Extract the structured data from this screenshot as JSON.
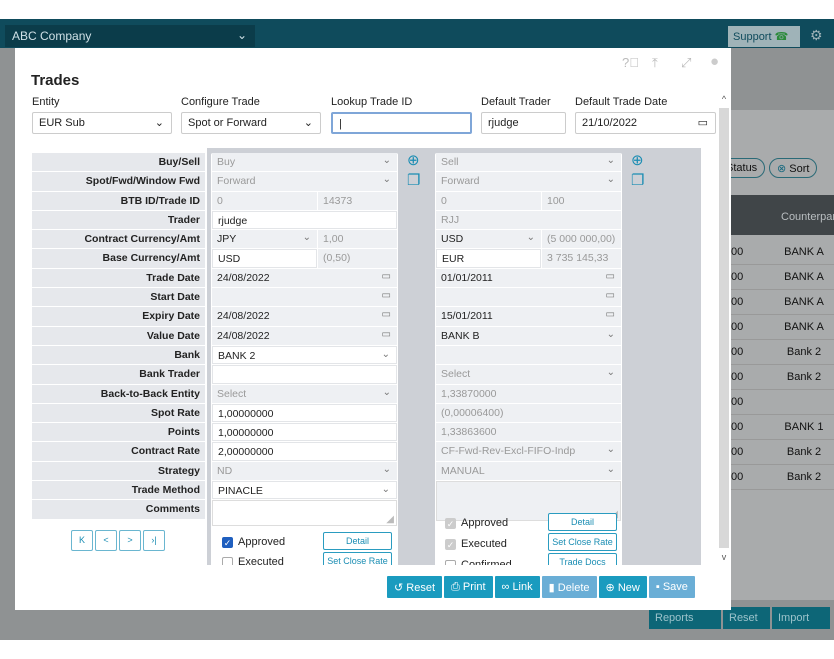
{
  "app": {
    "company": "ABC Company",
    "support": "Support"
  },
  "background": {
    "status_pill": "Status",
    "sort_pill": "Sort",
    "column_header": "Counterparty",
    "rows": [
      {
        "n": "00",
        "c": "BANK A"
      },
      {
        "n": "00",
        "c": "BANK A"
      },
      {
        "n": "00",
        "c": "BANK A"
      },
      {
        "n": "00",
        "c": "BANK A"
      },
      {
        "n": "00",
        "c": "Bank 2"
      },
      {
        "n": "00",
        "c": "Bank 2"
      },
      {
        "n": "00",
        "c": ""
      },
      {
        "n": "00",
        "c": "BANK 1"
      },
      {
        "n": "00",
        "c": "Bank 2"
      },
      {
        "n": "00",
        "c": "Bank 2"
      }
    ],
    "buttons": [
      "Reports",
      "Reset",
      "Import"
    ]
  },
  "modal": {
    "title": "Trades",
    "header": {
      "entity_label": "Entity",
      "entity_value": "EUR Sub",
      "configure_label": "Configure Trade",
      "configure_value": "Spot or Forward",
      "lookup_label": "Lookup Trade ID",
      "lookup_value": "",
      "trader_label": "Default Trader",
      "trader_value": "rjudge",
      "date_label": "Default Trade Date",
      "date_value": "21/10/2022"
    },
    "labels": [
      "Buy/Sell",
      "Spot/Fwd/Window Fwd",
      "BTB ID/Trade ID",
      "Trader",
      "Contract Currency/Amt",
      "Base Currency/Amt",
      "Trade Date",
      "Start Date",
      "Expiry Date",
      "Value Date",
      "Bank",
      "Bank Trader",
      "Back-to-Back Entity",
      "Spot Rate",
      "Points",
      "Contract Rate",
      "Strategy",
      "Trade Method",
      "Comments"
    ],
    "left": [
      [
        {
          "t": "Buy",
          "i": "dd",
          "s": "m"
        }
      ],
      [
        {
          "t": "Forward",
          "i": "dd",
          "s": "m"
        }
      ],
      [
        {
          "t": "0",
          "s": "m"
        },
        {
          "t": "14373",
          "s": "m"
        }
      ],
      [
        {
          "t": "rjudge",
          "s": "w"
        }
      ],
      [
        {
          "t": "JPY",
          "i": "dd"
        },
        {
          "t": "1,00",
          "s": "m"
        }
      ],
      [
        {
          "t": "USD",
          "s": "w"
        },
        {
          "t": "(0,50)",
          "s": "m"
        }
      ],
      [
        {
          "t": "24/08/2022",
          "i": "cal"
        }
      ],
      [
        {
          "t": "",
          "i": "cal"
        }
      ],
      [
        {
          "t": "24/08/2022",
          "i": "cal"
        }
      ],
      [
        {
          "t": "24/08/2022",
          "i": "cal"
        }
      ],
      [
        {
          "t": "BANK 2",
          "i": "dd",
          "s": "w"
        }
      ],
      [
        {
          "t": "",
          "s": "w"
        }
      ],
      [
        {
          "t": "Select",
          "i": "dd",
          "s": "m"
        }
      ],
      [
        {
          "t": "1,00000000",
          "s": "w"
        }
      ],
      [
        {
          "t": "1,00000000",
          "s": "w"
        }
      ],
      [
        {
          "t": "2,00000000",
          "s": "w"
        }
      ],
      [
        {
          "t": "ND",
          "i": "dd",
          "s": "m"
        }
      ],
      [
        {
          "t": "PINACLE",
          "i": "dd",
          "s": "w"
        }
      ],
      [
        {
          "t": "",
          "ta": true
        }
      ]
    ],
    "right": [
      [
        {
          "t": "Sell",
          "i": "dd",
          "s": "m"
        }
      ],
      [
        {
          "t": "Forward",
          "i": "dd",
          "s": "m"
        }
      ],
      [
        {
          "t": "0",
          "s": "m"
        },
        {
          "t": "100",
          "s": "m"
        }
      ],
      [
        {
          "t": "RJJ",
          "s": "m"
        }
      ],
      [
        {
          "t": "USD",
          "i": "dd"
        },
        {
          "t": "(5 000 000,00)",
          "s": "m"
        }
      ],
      [
        {
          "t": "EUR",
          "s": "w"
        },
        {
          "t": "3 735 145,33",
          "s": "m"
        }
      ],
      [
        {
          "t": "01/01/2011",
          "i": "cal"
        }
      ],
      [
        {
          "t": "",
          "i": "cal"
        }
      ],
      [
        {
          "t": "15/01/2011",
          "i": "cal"
        }
      ],
      [
        {
          "t": "BANK B",
          "i": "dd"
        }
      ],
      [
        {
          "t": ""
        }
      ],
      [
        {
          "t": "Select",
          "i": "dd",
          "s": "m"
        }
      ],
      [
        {
          "t": "1,33870000",
          "s": "m"
        }
      ],
      [
        {
          "t": "(0,00006400)",
          "s": "m"
        }
      ],
      [
        {
          "t": "1,33863600",
          "s": "m"
        }
      ],
      [
        {
          "t": "CF-Fwd-Rev-Excl-FIFO-Indp",
          "i": "dd",
          "s": "m"
        }
      ],
      [
        {
          "t": "MANUAL",
          "i": "dd",
          "s": "m"
        }
      ],
      [
        {
          "t": "",
          "ta": true,
          "g": true
        }
      ]
    ],
    "left_checks": [
      {
        "label": "Approved",
        "checked": true
      },
      {
        "label": "Executed",
        "checked": false
      }
    ],
    "right_checks": [
      {
        "label": "Approved",
        "checked": true
      },
      {
        "label": "Executed",
        "checked": true
      },
      {
        "label": "Confirmed",
        "checked": false
      }
    ],
    "left_buttons": [
      "Detail",
      "Set Close Rate"
    ],
    "right_buttons": [
      "Detail",
      "Set Close Rate",
      "Trade Docs"
    ],
    "pager": [
      "K",
      "<",
      ">",
      "›|"
    ],
    "actions": [
      {
        "label": "Reset",
        "icon": "↺",
        "enabled": true
      },
      {
        "label": "Print",
        "icon": "⎙",
        "enabled": true
      },
      {
        "label": "Link",
        "icon": "∞",
        "enabled": true
      },
      {
        "label": "Delete",
        "icon": "▮",
        "enabled": false
      },
      {
        "label": "New",
        "icon": "⊕",
        "enabled": true
      },
      {
        "label": "Save",
        "icon": "▪",
        "enabled": false
      }
    ]
  },
  "colors": {
    "header": "#0f4b5c",
    "accent": "#1a9bbf",
    "disabled": "#6aaed6"
  }
}
